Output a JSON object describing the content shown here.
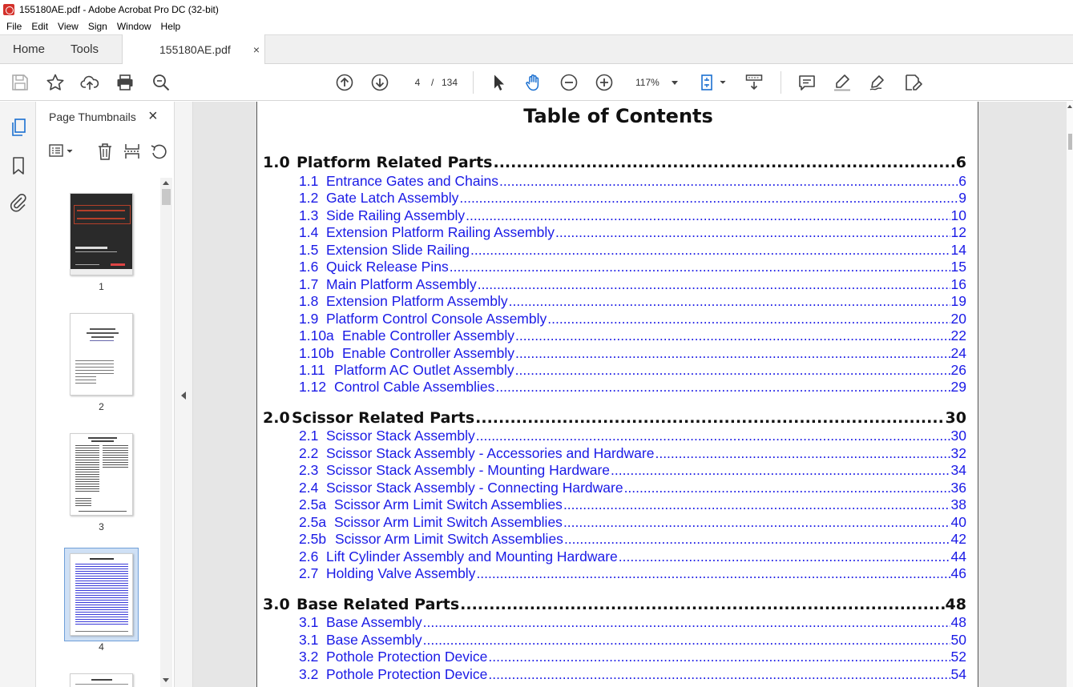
{
  "window": {
    "title": "155180AE.pdf - Adobe Acrobat Pro DC (32-bit)"
  },
  "menu": [
    "File",
    "Edit",
    "View",
    "Sign",
    "Window",
    "Help"
  ],
  "tabs": {
    "home": "Home",
    "tools": "Tools",
    "document": "155180AE.pdf",
    "close": "×"
  },
  "toolbar": {
    "page_current": "4",
    "page_sep": "/",
    "page_total": "134",
    "zoom": "117%"
  },
  "thumbnails_panel": {
    "title": "Page Thumbnails",
    "close": "×",
    "pages": [
      "1",
      "2",
      "3",
      "4"
    ],
    "selected_page": "4"
  },
  "toc": {
    "title": "Table of Contents",
    "sections": [
      {
        "num": "1.0",
        "label": "Platform Related Parts",
        "page": "6",
        "items": [
          {
            "num": "1.1",
            "label": "Entrance Gates and Chains",
            "page": "6"
          },
          {
            "num": "1.2",
            "label": "Gate Latch Assembly",
            "page": "9"
          },
          {
            "num": "1.3",
            "label": "Side Railing Assembly",
            "page": "10"
          },
          {
            "num": "1.4",
            "label": "Extension Platform Railing Assembly",
            "page": "12"
          },
          {
            "num": "1.5",
            "label": "Extension Slide Railing",
            "page": "14"
          },
          {
            "num": "1.6",
            "label": "Quick Release Pins",
            "page": "15"
          },
          {
            "num": "1.7",
            "label": "Main Platform Assembly",
            "page": "16"
          },
          {
            "num": "1.8",
            "label": "Extension Platform Assembly",
            "page": "19"
          },
          {
            "num": "1.9",
            "label": "Platform Control Console Assembly",
            "page": "20"
          },
          {
            "num": "1.10a",
            "label": "Enable Controller Assembly",
            "page": "22"
          },
          {
            "num": "1.10b",
            "label": "Enable Controller Assembly",
            "page": "24"
          },
          {
            "num": "1.11",
            "label": "Platform AC Outlet Assembly",
            "page": "26"
          },
          {
            "num": "1.12",
            "label": "Control Cable Assemblies",
            "page": "29"
          }
        ]
      },
      {
        "num": "2.0",
        "label": "Scissor Related Parts",
        "page": "30",
        "items": [
          {
            "num": "2.1",
            "label": "Scissor Stack Assembly",
            "page": "30"
          },
          {
            "num": "2.2",
            "label": "Scissor Stack Assembly - Accessories and Hardware",
            "page": "32"
          },
          {
            "num": "2.3",
            "label": "Scissor Stack Assembly - Mounting Hardware",
            "page": "34"
          },
          {
            "num": "2.4",
            "label": "Scissor Stack Assembly - Connecting Hardware",
            "page": "36"
          },
          {
            "num": "2.5a",
            "label": "Scissor Arm Limit Switch Assemblies",
            "page": "38"
          },
          {
            "num": "2.5a",
            "label": "Scissor Arm Limit Switch Assemblies",
            "page": "40"
          },
          {
            "num": "2.5b",
            "label": "Scissor Arm Limit Switch Assemblies",
            "page": "42"
          },
          {
            "num": "2.6",
            "label": "Lift Cylinder Assembly and Mounting Hardware",
            "page": "44"
          },
          {
            "num": "2.7",
            "label": "Holding Valve Assembly",
            "page": "46"
          }
        ]
      },
      {
        "num": "3.0",
        "label": "Base Related Parts",
        "page": "48",
        "items": [
          {
            "num": "3.1",
            "label": "Base Assembly",
            "page": "48"
          },
          {
            "num": "3.1",
            "label": "Base Assembly",
            "page": "50"
          },
          {
            "num": "3.2",
            "label": "Pothole Protection Device",
            "page": "52"
          },
          {
            "num": "3.2",
            "label": "Pothole Protection Device",
            "page": "54"
          }
        ]
      }
    ]
  },
  "colors": {
    "link_blue": "#1a1ae6",
    "acrobat_red": "#d4312b",
    "selection": "#cfe0f5"
  }
}
